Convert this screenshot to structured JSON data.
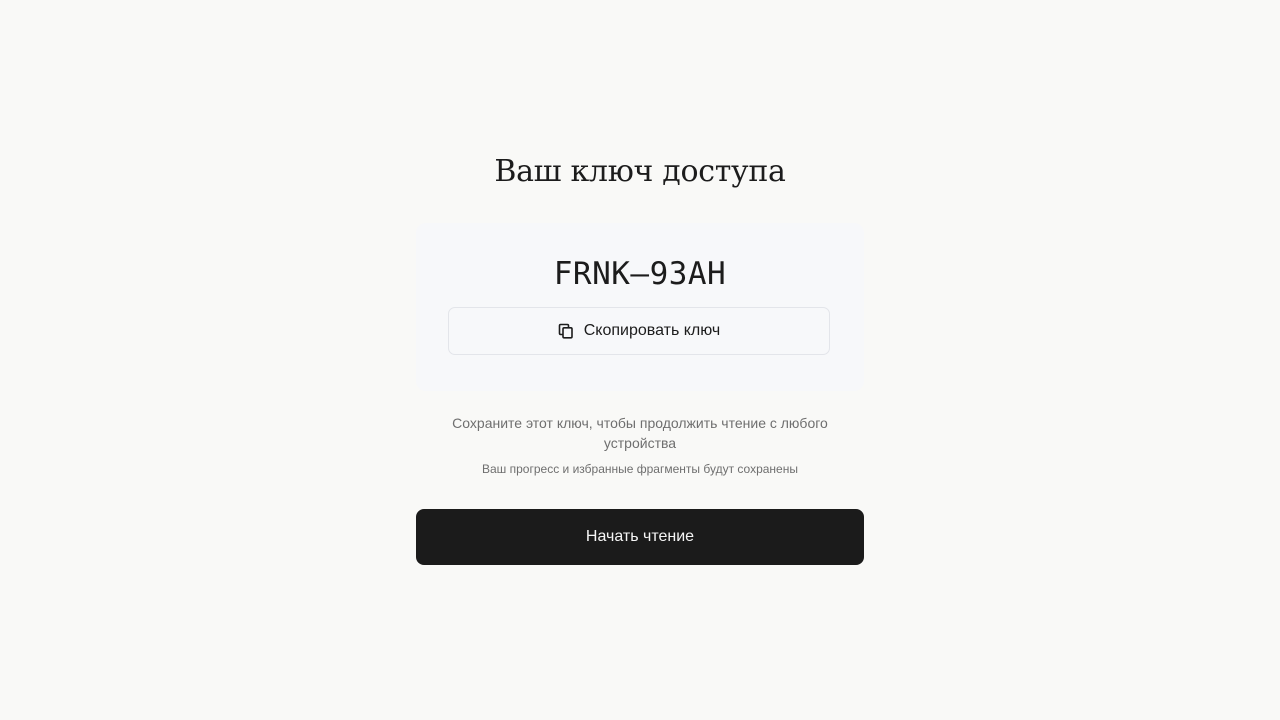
{
  "title": "Ваш ключ доступа",
  "key_card": {
    "key_value": "FRNK–93AH",
    "copy_button": {
      "icon": "copy-icon",
      "label": "Скопировать ключ"
    }
  },
  "hint": {
    "primary": "Сохраните этот ключ, чтобы продолжить чтение с любого устройства",
    "secondary": "Ваш прогресс и избранные фрагменты будут сохранены"
  },
  "start_button": {
    "label": "Начать чтение"
  },
  "colors": {
    "background": "#f9f9f7",
    "card_background": "#f7f8fa",
    "primary_button": "#1b1b1b",
    "muted_text": "#6f6f6f"
  }
}
